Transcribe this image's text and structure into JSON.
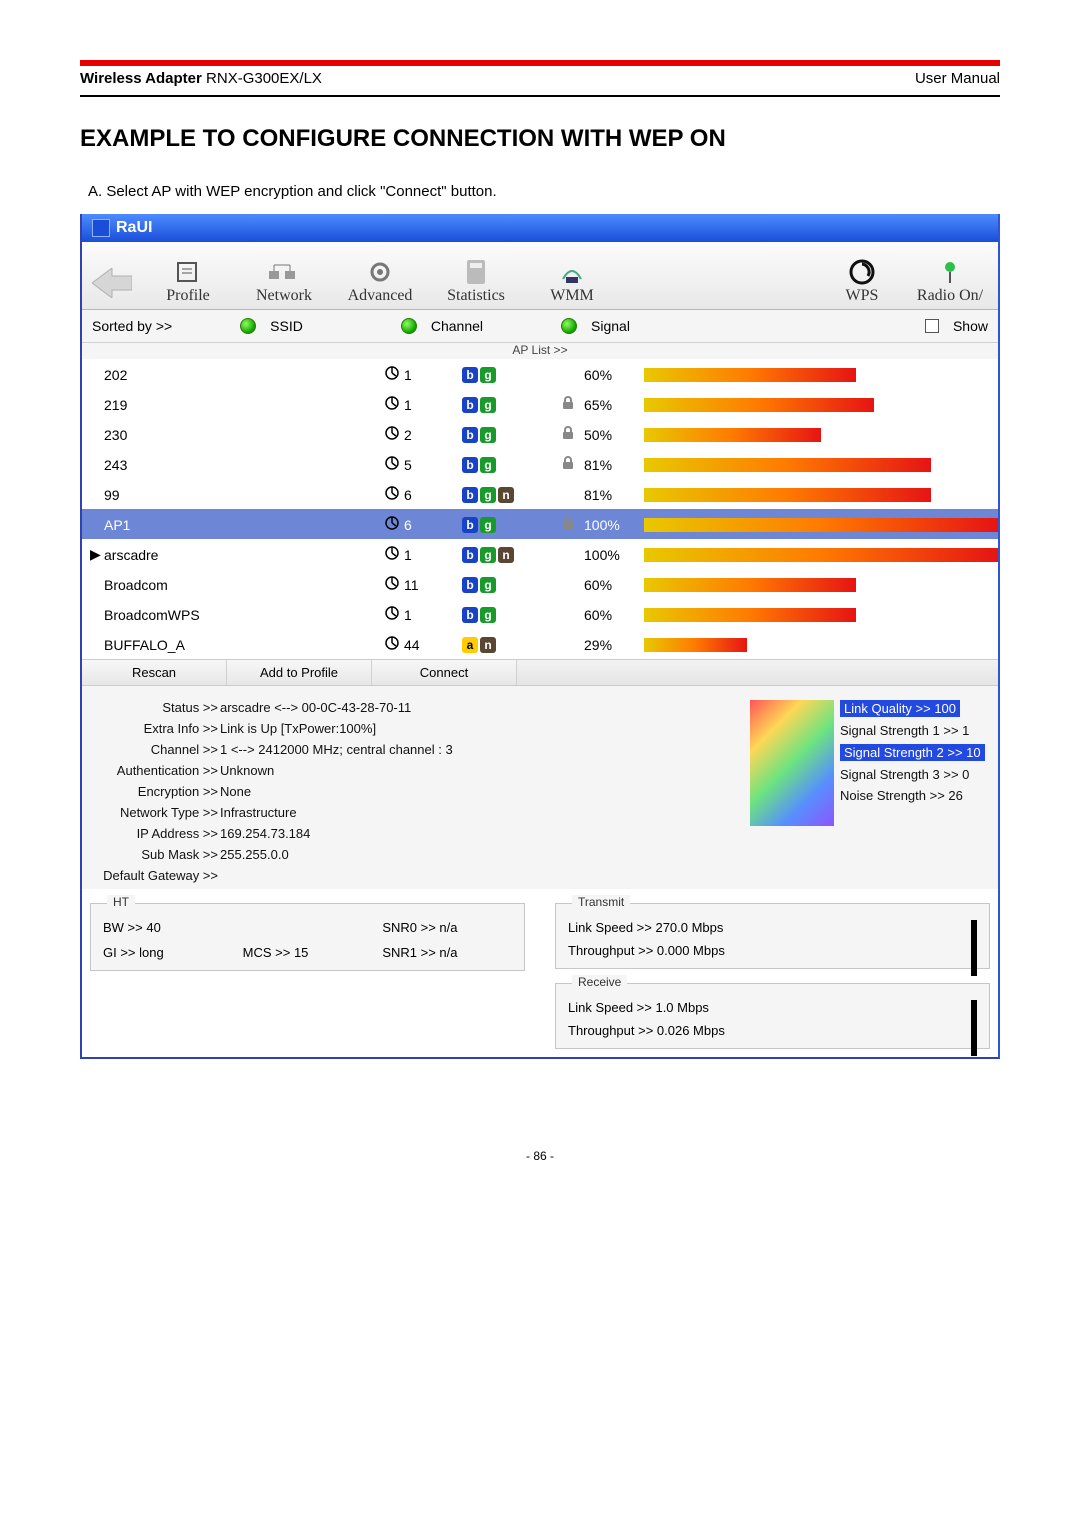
{
  "header": {
    "product_bold": "Wireless Adapter",
    "product_rest": " RNX-G300EX/LX",
    "right": "User Manual"
  },
  "section_title": "EXAMPLE TO CONFIGURE CONNECTION WITH WEP ON",
  "step_a": "A. Select AP with WEP encryption and click \"Connect\" button.",
  "window_title": "RaUI",
  "toolbar": {
    "profile": "Profile",
    "network": "Network",
    "advanced": "Advanced",
    "statistics": "Statistics",
    "wmm": "WMM",
    "wps": "WPS",
    "radio": "Radio On/"
  },
  "sortbar": {
    "sorted": "Sorted by >>",
    "ssid": "SSID",
    "channel": "Channel",
    "signal": "Signal",
    "show": "Show"
  },
  "ap_list_label": "AP List >>",
  "aps": [
    {
      "ssid": "202",
      "ch": "1",
      "modes": [
        "b",
        "g"
      ],
      "lock": false,
      "sig": "60%",
      "bar": 60
    },
    {
      "ssid": "219",
      "ch": "1",
      "modes": [
        "b",
        "g"
      ],
      "lock": true,
      "sig": "65%",
      "bar": 65
    },
    {
      "ssid": "230",
      "ch": "2",
      "modes": [
        "b",
        "g"
      ],
      "lock": true,
      "sig": "50%",
      "bar": 50
    },
    {
      "ssid": "243",
      "ch": "5",
      "modes": [
        "b",
        "g"
      ],
      "lock": true,
      "sig": "81%",
      "bar": 81
    },
    {
      "ssid": "99",
      "ch": "6",
      "modes": [
        "b",
        "g",
        "n"
      ],
      "lock": false,
      "sig": "81%",
      "bar": 81
    },
    {
      "ssid": "AP1",
      "ch": "6",
      "modes": [
        "b",
        "g"
      ],
      "lock": true,
      "sig": "100%",
      "bar": 100,
      "selected": true
    },
    {
      "ssid": "arscadre",
      "ch": "1",
      "modes": [
        "b",
        "g",
        "n"
      ],
      "lock": false,
      "sig": "100%",
      "bar": 100,
      "current": true
    },
    {
      "ssid": "Broadcom",
      "ch": "11",
      "modes": [
        "b",
        "g"
      ],
      "lock": false,
      "sig": "60%",
      "bar": 60
    },
    {
      "ssid": "BroadcomWPS",
      "ch": "1",
      "modes": [
        "b",
        "g"
      ],
      "lock": false,
      "sig": "60%",
      "bar": 60
    },
    {
      "ssid": "BUFFALO_A",
      "ch": "44",
      "modes": [
        "a",
        "n"
      ],
      "lock": false,
      "sig": "29%",
      "bar": 29
    }
  ],
  "actions": {
    "rescan": "Rescan",
    "add": "Add to Profile",
    "connect": "Connect"
  },
  "status": {
    "Status": "arscadre <--> 00-0C-43-28-70-11",
    "ExtraInfo": "Link is Up [TxPower:100%]",
    "Channel": "1 <--> 2412000 MHz; central channel : 3",
    "Authentication": "Unknown",
    "Encryption": "None",
    "NetworkType": "Infrastructure",
    "IPAddress": "169.254.73.184",
    "SubMask": "255.255.0.0",
    "DefaultGateway": ""
  },
  "labels": {
    "Status": "Status >>",
    "ExtraInfo": "Extra Info >>",
    "Channel": "Channel >>",
    "Authentication": "Authentication >>",
    "Encryption": "Encryption >>",
    "NetworkType": "Network Type >>",
    "IPAddress": "IP Address >>",
    "SubMask": "Sub Mask >>",
    "DefaultGateway": "Default Gateway >>"
  },
  "signals": {
    "lq": "Link Quality >> 100",
    "s1": "Signal Strength 1 >> 1",
    "s2": "Signal Strength 2 >> 10",
    "s3": "Signal Strength 3 >> 0",
    "noise": "Noise Strength >> 26"
  },
  "ht": {
    "title": "HT",
    "bw": "BW >>  40",
    "gi": "GI >>  long",
    "mcs": "MCS >>  15",
    "snr0": "SNR0 >>  n/a",
    "snr1": "SNR1 >>  n/a"
  },
  "tx": {
    "title": "Transmit",
    "ls": "Link Speed >>  270.0 Mbps",
    "tp": "Throughput >>  0.000 Mbps"
  },
  "rx": {
    "title": "Receive",
    "ls": "Link Speed >>  1.0 Mbps",
    "tp": "Throughput >>  0.026 Mbps"
  },
  "page_no": "- 86 -"
}
